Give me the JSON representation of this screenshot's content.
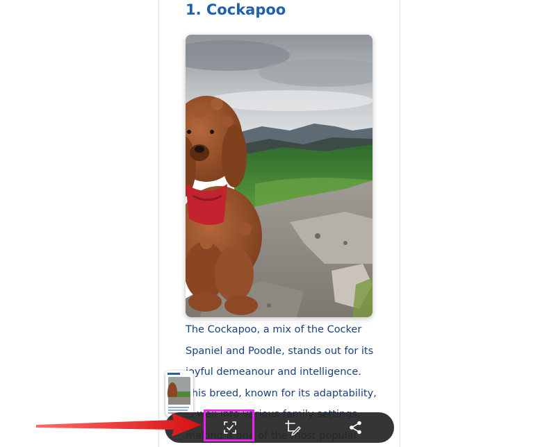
{
  "article": {
    "heading": "1. Cockapoo",
    "image_subject": "cockapoo-photo",
    "paragraph_lines": [
      "The Cockapoo, a mix of the Cocker",
      "Spaniel and Poodle, stands out for its",
      "joyful demeanour and intelligence.",
      "This breed, known for its adaptability,",
      "is well into various family settings,",
      "making it one of the most popular"
    ]
  },
  "screenshot_toolbar": {
    "buttons": [
      {
        "name": "scan-text",
        "icon": "scan-text-icon",
        "highlighted": true
      },
      {
        "name": "edit",
        "icon": "crop-edit-icon"
      },
      {
        "name": "share",
        "icon": "share-icon"
      }
    ]
  },
  "annotations": {
    "arrow_color": "#e81c1c",
    "highlight_color": "#ee22ee"
  },
  "colors": {
    "heading": "#1f5fb0",
    "body_text": "#1a3f7a",
    "toolbar_bg": "#262626"
  }
}
